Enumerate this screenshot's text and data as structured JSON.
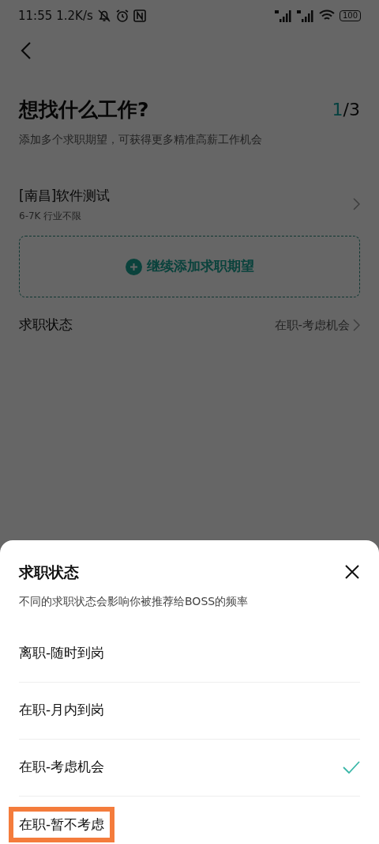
{
  "status_bar": {
    "time": "11:55",
    "speed": "1.2K/s",
    "battery": "100"
  },
  "page": {
    "title": "想找什么工作?",
    "step_current": "1",
    "step_total": "/3",
    "subtitle": "添加多个求职期望，可获得更多精准高薪工作机会",
    "expectations": [
      {
        "title": "[南昌]软件测试",
        "detail": "6-7K 行业不限"
      }
    ],
    "add_button": "继续添加求职期望",
    "status_row": {
      "label": "求职状态",
      "value": "在职-考虑机会"
    }
  },
  "sheet": {
    "title": "求职状态",
    "description": "不同的求职状态会影响你被推荐给BOSS的频率",
    "options": [
      {
        "label": "离职-随时到岗",
        "selected": false,
        "highlighted": false
      },
      {
        "label": "在职-月内到岗",
        "selected": false,
        "highlighted": false
      },
      {
        "label": "在职-考虑机会",
        "selected": true,
        "highlighted": false
      },
      {
        "label": "在职-暂不考虑",
        "selected": false,
        "highlighted": true
      }
    ]
  }
}
